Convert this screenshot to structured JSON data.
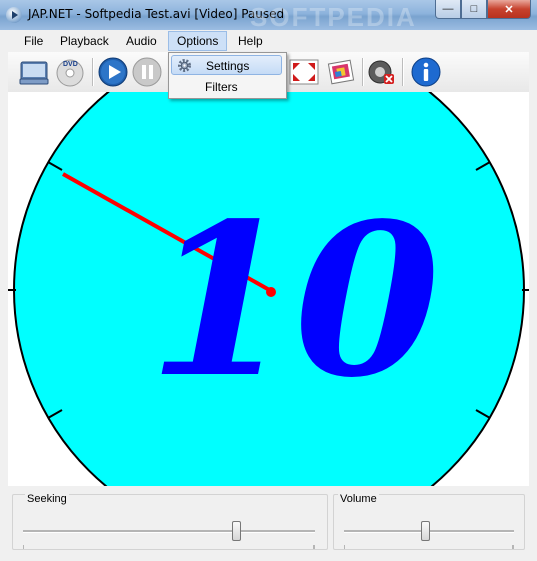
{
  "window": {
    "title": "JAP.NET - Softpedia Test.avi [Video] Paused",
    "watermark": "SOFTPEDIA"
  },
  "menubar": {
    "items": [
      {
        "label": "File"
      },
      {
        "label": "Playback"
      },
      {
        "label": "Audio"
      },
      {
        "label": "Options"
      },
      {
        "label": "Help"
      }
    ]
  },
  "options_menu": {
    "items": [
      {
        "label": "Settings",
        "icon": "gear-icon"
      },
      {
        "label": "Filters"
      }
    ]
  },
  "toolbar": {
    "buttons": [
      {
        "name": "open-file",
        "icon": "open-file-icon"
      },
      {
        "name": "open-dvd",
        "icon": "dvd-icon"
      },
      {
        "name": "play",
        "icon": "play-icon"
      },
      {
        "name": "pause",
        "icon": "pause-icon"
      },
      {
        "name": "fullscreen",
        "icon": "fullscreen-icon"
      },
      {
        "name": "screenshot",
        "icon": "picture-icon"
      },
      {
        "name": "mute",
        "icon": "speaker-mute-icon"
      },
      {
        "name": "about",
        "icon": "info-icon"
      }
    ]
  },
  "video": {
    "frame_number": "10",
    "colors": {
      "face": "#00ffff",
      "number": "#0000ff",
      "hand": "#ff0000"
    }
  },
  "controls": {
    "seeking_label": "Seeking",
    "seeking_position": 0.73,
    "volume_label": "Volume",
    "volume_level": 0.48
  }
}
